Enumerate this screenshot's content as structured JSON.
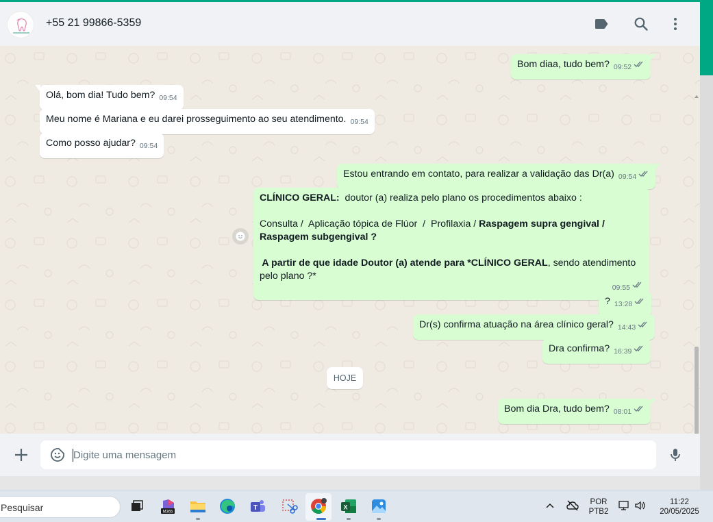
{
  "header": {
    "contact_name": "+55 21 99866-5359",
    "icons": [
      "label-icon",
      "search-icon",
      "menu-dots-icon"
    ]
  },
  "messages": [
    {
      "direction": "out",
      "text": "Bom diaa, tudo bem?",
      "time": "09:52",
      "status": "read"
    },
    {
      "direction": "in",
      "text": "Olá, bom dia! Tudo bem?",
      "time": "09:54"
    },
    {
      "direction": "in",
      "text": "Meu nome é Mariana e eu darei prosseguimento ao seu atendimento.",
      "time": "09:54"
    },
    {
      "direction": "in",
      "text": "Como posso ajudar?",
      "time": "09:54"
    },
    {
      "direction": "out",
      "text": "Estou entrando em contato, para realizar a validação das Dr(a)",
      "time": "09:54",
      "status": "read"
    },
    {
      "direction": "out",
      "time": "09:55",
      "status": "read",
      "line1_bold": "CLÍNICO GERAL:",
      "line1_rest": "  doutor (a) realiza pelo plano os procedimentos abaixo :",
      "line2_normal": "Consulta /  Aplicação tópica de Flúor  /  Profilaxia / ",
      "line2_bold": "Raspagem supra gengival /",
      "line3_bold": "Raspagem subgengival ?",
      "line4_bold": " A partir de que idade Doutor (a) atende para *CLÍNICO GERAL",
      "line4_rest": ", sendo atendimento",
      "line5": "pelo plano ?*"
    },
    {
      "direction": "out",
      "text": "?",
      "time": "13:28",
      "status": "read"
    },
    {
      "direction": "out",
      "text": "Dr(s) confirma atuação na área clínico geral?",
      "time": "14:43",
      "status": "read"
    },
    {
      "direction": "out",
      "text": "Dra confirma?",
      "time": "16:39",
      "status": "read"
    },
    {
      "direction": "out",
      "text": "Bom dia Dra, tudo bem?",
      "time": "08:01",
      "status": "read"
    }
  ],
  "day_separator": "HOJE",
  "composer": {
    "placeholder": "Digite uma mensagem"
  },
  "taskbar": {
    "search_placeholder": "Pesquisar",
    "apps": [
      "task-view",
      "microsoft-365",
      "file-explorer",
      "edge",
      "teams",
      "snipping-tool",
      "chrome",
      "excel",
      "photos"
    ],
    "lang_line1": "POR",
    "lang_line2": "PTB2",
    "time": "11:22",
    "date": "20/05/2025"
  },
  "colors": {
    "accent": "#00a884",
    "outgoing_bubble": "#d9fdd3",
    "incoming_bubble": "#ffffff",
    "chat_bg": "#efeae2",
    "read_ticks": "#667781"
  }
}
